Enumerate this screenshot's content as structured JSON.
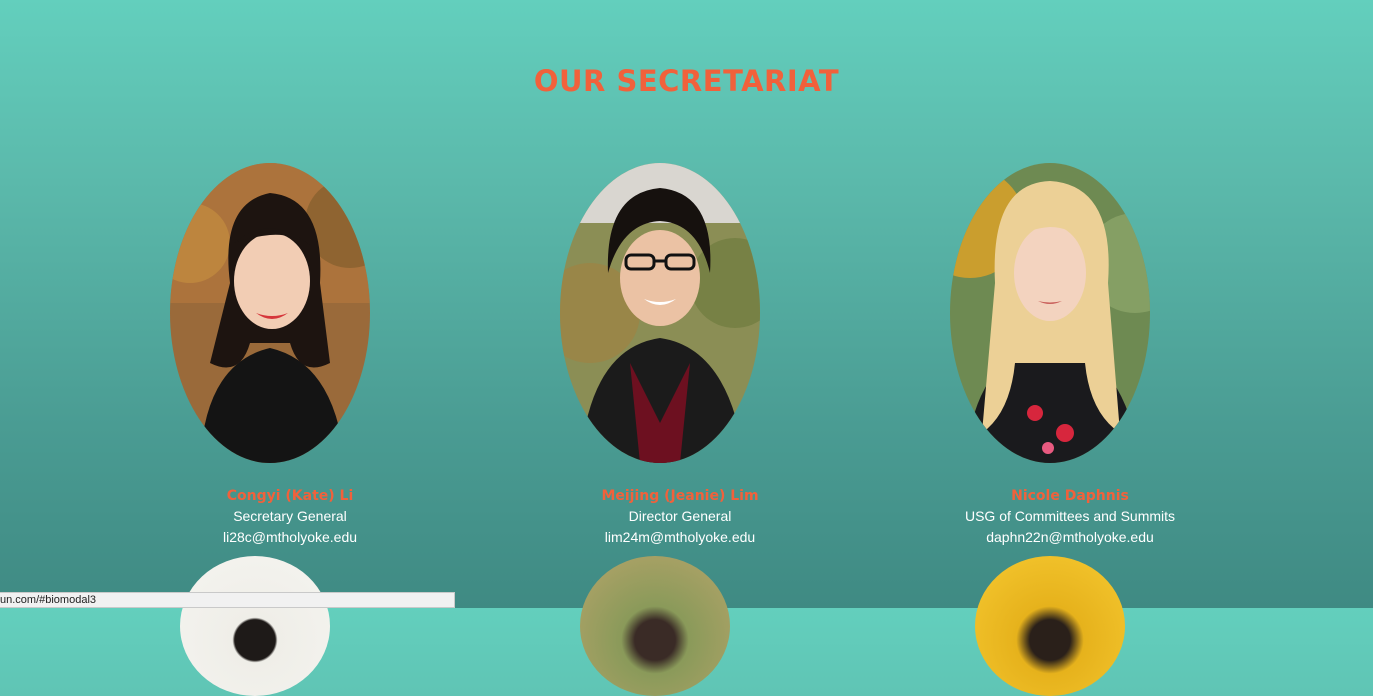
{
  "section": {
    "title": "OUR SECRETARIAT"
  },
  "members": [
    {
      "name": "Congyi (Kate) Li",
      "role": "Secretary General",
      "email": "li28c@mtholyoke.edu"
    },
    {
      "name": "Meijing (Jeanie) Lim",
      "role": "Director General",
      "email": "lim24m@mtholyoke.edu"
    },
    {
      "name": "Nicole Daphnis",
      "role": "USG of Committees and Summits",
      "email": "daphn22n@mtholyoke.edu"
    }
  ],
  "status_bar": {
    "url": "un.com/#biomodal3"
  },
  "colors": {
    "accent": "#f1613b",
    "text": "#ffffff",
    "bg_top": "#63cfbd",
    "bg_bottom": "#3f8a83"
  }
}
